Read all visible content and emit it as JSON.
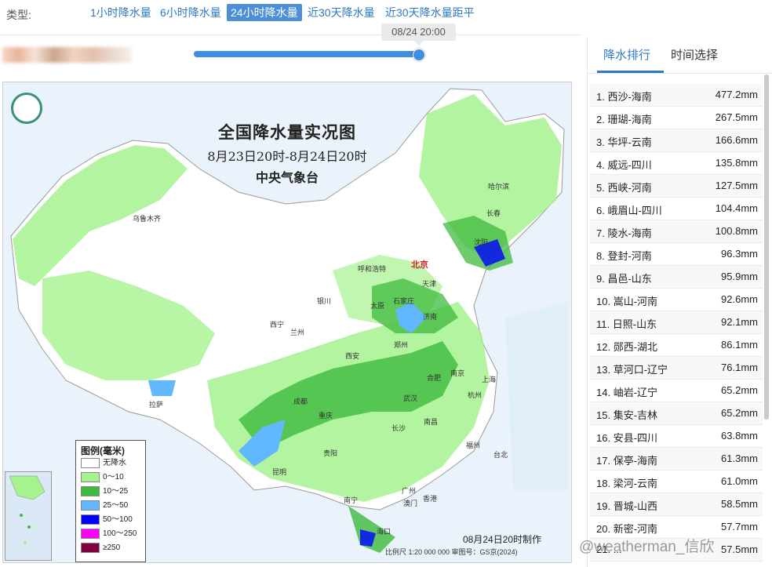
{
  "typebar": {
    "label": "类型:",
    "tabs": [
      {
        "label": "1小时降水量",
        "active": false
      },
      {
        "label": "6小时降水量",
        "active": false
      },
      {
        "label": "24小时降水量",
        "active": true
      },
      {
        "label": "近30天降水量",
        "active": false
      },
      {
        "label": "近30天降水量距平",
        "active": false
      }
    ]
  },
  "slider": {
    "time_label": "08/24 20:00",
    "position_fraction": 1.0
  },
  "map": {
    "title": "全国降水量实况图",
    "subtitle": "8月23日20时-8月24日20时",
    "issuer": "中央气象台",
    "cities": [
      "哈尔滨",
      "长春",
      "沈阳",
      "北京",
      "天津",
      "呼和浩特",
      "石家庄",
      "太原",
      "济南",
      "银川",
      "西宁",
      "兰州",
      "郑州",
      "西安",
      "合肥",
      "南京",
      "上海",
      "杭州",
      "武汉",
      "成都",
      "重庆",
      "南昌",
      "长沙",
      "福州",
      "台北",
      "贵阳",
      "昆明",
      "南宁",
      "广州",
      "澳门",
      "香港",
      "海口",
      "乌鲁木齐",
      "拉萨"
    ],
    "legend": {
      "title": "图例(毫米)",
      "items": [
        {
          "label": "无降水",
          "color": "#ffffff"
        },
        {
          "label": "0～10",
          "color": "#a6f28f"
        },
        {
          "label": "10～25",
          "color": "#3dba3d"
        },
        {
          "label": "25～50",
          "color": "#61b8ff"
        },
        {
          "label": "50～100",
          "color": "#0000ff"
        },
        {
          "label": "100～250",
          "color": "#fa00fa"
        },
        {
          "label": "≥250",
          "color": "#800040"
        }
      ]
    },
    "scale_text": "比例尺 1:20 000 000      审图号：GS京(2024)",
    "produced": "08月24日20时制作"
  },
  "right_panel": {
    "tabs": [
      {
        "label": "降水排行",
        "active": true
      },
      {
        "label": "时间选择",
        "active": false
      }
    ],
    "ranking": [
      {
        "rank": "1.",
        "name": "西沙-海南",
        "value": "477.2mm"
      },
      {
        "rank": "2.",
        "name": "珊瑚-海南",
        "value": "267.5mm"
      },
      {
        "rank": "3.",
        "name": "华坪-云南",
        "value": "166.6mm"
      },
      {
        "rank": "4.",
        "name": "威远-四川",
        "value": "135.8mm"
      },
      {
        "rank": "5.",
        "name": "西峡-河南",
        "value": "127.5mm"
      },
      {
        "rank": "6.",
        "name": "峨眉山-四川",
        "value": "104.4mm"
      },
      {
        "rank": "7.",
        "name": "陵水-海南",
        "value": "100.8mm"
      },
      {
        "rank": "8.",
        "name": "登封-河南",
        "value": "96.3mm"
      },
      {
        "rank": "9.",
        "name": "昌邑-山东",
        "value": "95.9mm"
      },
      {
        "rank": "10.",
        "name": "嵩山-河南",
        "value": "92.6mm"
      },
      {
        "rank": "11.",
        "name": "日照-山东",
        "value": "92.1mm"
      },
      {
        "rank": "12.",
        "name": "郧西-湖北",
        "value": "86.1mm"
      },
      {
        "rank": "13.",
        "name": "草河口-辽宁",
        "value": "76.1mm"
      },
      {
        "rank": "14.",
        "name": "岫岩-辽宁",
        "value": "65.2mm"
      },
      {
        "rank": "15.",
        "name": "集安-吉林",
        "value": "65.2mm"
      },
      {
        "rank": "16.",
        "name": "安县-四川",
        "value": "63.8mm"
      },
      {
        "rank": "17.",
        "name": "保亭-海南",
        "value": "61.3mm"
      },
      {
        "rank": "18.",
        "name": "梁河-云南",
        "value": "61.0mm"
      },
      {
        "rank": "19.",
        "name": "晋城-山西",
        "value": "58.5mm"
      },
      {
        "rank": "20.",
        "name": "新密-河南",
        "value": "57.7mm"
      },
      {
        "rank": "21.",
        "name": "...",
        "value": "57.5mm"
      }
    ]
  },
  "watermark": "@weatherman_信欣"
}
